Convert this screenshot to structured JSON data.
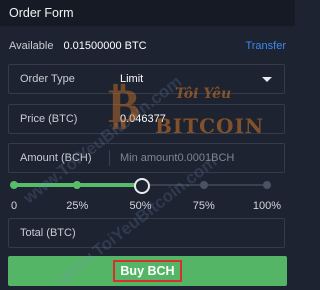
{
  "header": {
    "title": "Order Form"
  },
  "available": {
    "label": "Available",
    "value": "0.01500000 BTC",
    "transfer_label": "Transfer"
  },
  "order_type": {
    "label": "Order Type",
    "value": "Limit"
  },
  "price": {
    "label": "Price (BTC)",
    "value": "0.046377"
  },
  "amount": {
    "label": "Amount (BCH)",
    "placeholder": "Min amount0.0001BCH"
  },
  "slider": {
    "percent": 50,
    "marks": [
      "0",
      "25%",
      "50%",
      "75%",
      "100%"
    ]
  },
  "total": {
    "label": "Total (BTC)"
  },
  "buy_button": {
    "label": "Buy BCH"
  },
  "watermark": {
    "diagonal": "www.ToiYeuBitcoin.com",
    "logo_top": "Tôi Yêu",
    "logo_bottom": "BITCOIN"
  },
  "colors": {
    "accent_green": "#58bd6b",
    "link_blue": "#3b8af0",
    "highlight_red": "#d8312d"
  }
}
